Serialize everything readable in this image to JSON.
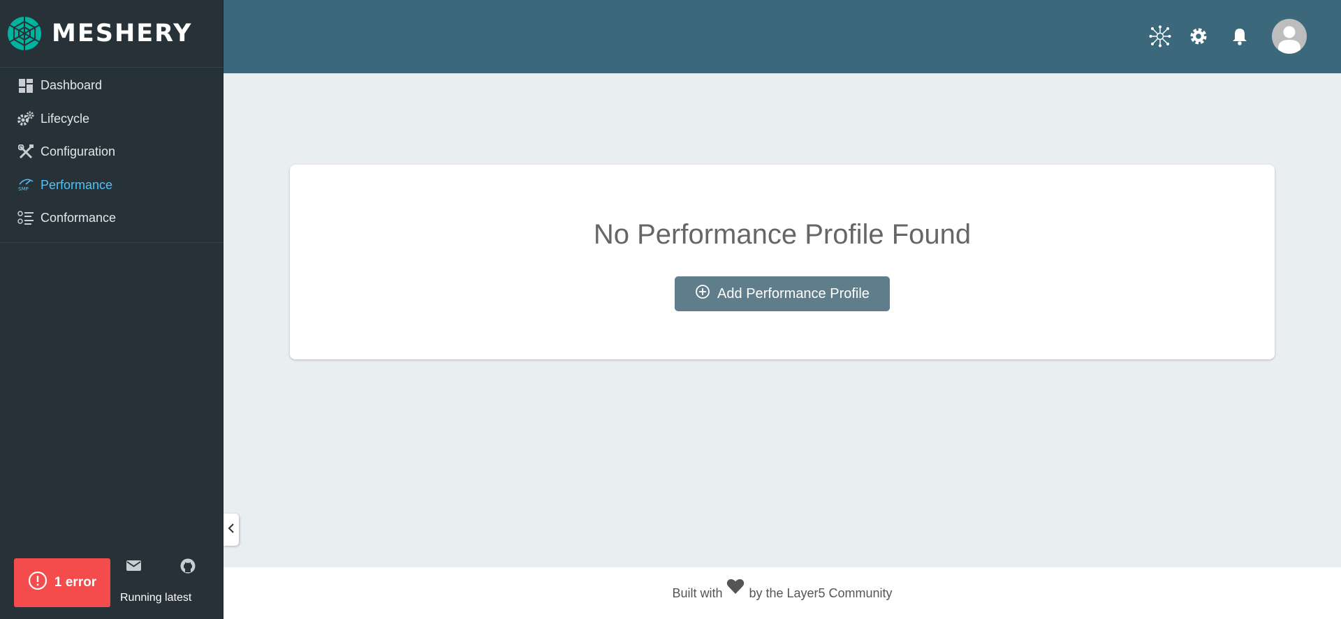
{
  "brand": {
    "name": "MESHERY"
  },
  "sidebar": {
    "items": [
      {
        "label": "Dashboard",
        "icon": "dashboard-icon"
      },
      {
        "label": "Lifecycle",
        "icon": "gears-icon"
      },
      {
        "label": "Configuration",
        "icon": "tools-icon"
      },
      {
        "label": "Performance",
        "icon": "smp-icon",
        "active": true
      },
      {
        "label": "Conformance",
        "icon": "checklist-icon"
      }
    ],
    "error_label": "1 error",
    "version_text": "Running latest"
  },
  "header": {
    "icons": [
      "service-mesh-icon",
      "gear-icon",
      "bell-icon",
      "avatar-icon"
    ]
  },
  "main": {
    "empty_title": "No Performance Profile Found",
    "add_button_label": "Add Performance Profile"
  },
  "footer": {
    "prefix": "Built with",
    "suffix": "by the Layer5 Community"
  },
  "colors": {
    "sidebar_bg": "#263238",
    "header_bg": "#3b687b",
    "active_nav": "#4fc3f7",
    "error_bg": "#f44c4c",
    "button_bg": "#607d8b",
    "brand_accent": "#00b39f"
  }
}
